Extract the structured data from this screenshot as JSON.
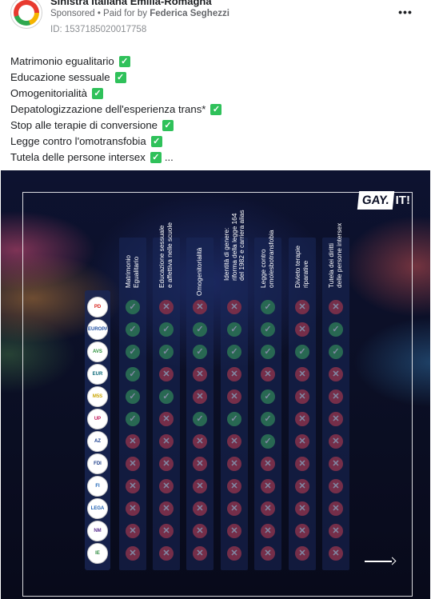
{
  "header": {
    "page_name": "Sinistra Italiana Emilia-Romagna",
    "sponsored_label": "Sponsored",
    "paid_for_prefix": " • Paid for by ",
    "payer": "Federica Seghezzi",
    "ad_id": "ID: 1537185020017758",
    "more_icon": "more-horizontal-icon"
  },
  "body_lines": [
    "Matrimonio egualitario",
    "Educazione sessuale",
    "Omogenitorialità",
    "Depatologizzazione dell'esperienza trans*",
    "Stop alle terapie di conversione",
    "Legge contro l'omotransfobia",
    "Tutela delle persone intersex"
  ],
  "check_icon": "white-check-mark-icon",
  "ellipsis": "...",
  "creative": {
    "logo_gay": "GAY.",
    "logo_it": "IT!",
    "columns": [
      "Matrimonio\nEgualitario",
      "Educazione sessuale\ne affettiva nelle scuole",
      "Omogenitorialità",
      "Identità di genere:\nriforma della legge 164\ndel 1982 e carriera alias",
      "Legge contro\nomolesbotransfobia",
      "Divieto terapie\nriparative",
      "Tutela dei diritti\ndelle persone intersex"
    ],
    "parties": [
      {
        "abbr": "PD",
        "color": "#d7261e"
      },
      {
        "abbr": "EUROPA",
        "color": "#1f4fa3"
      },
      {
        "abbr": "AVS",
        "color": "#2b8f3b"
      },
      {
        "abbr": "EUR",
        "color": "#0c6a7a"
      },
      {
        "abbr": "M5S",
        "color": "#c9a400"
      },
      {
        "abbr": "UP",
        "color": "#c2185b"
      },
      {
        "abbr": "AZ",
        "color": "#143a8c"
      },
      {
        "abbr": "FDI",
        "color": "#1e3f8a"
      },
      {
        "abbr": "FI",
        "color": "#1a62b5"
      },
      {
        "abbr": "LEGA",
        "color": "#1f5fb0"
      },
      {
        "abbr": "NM",
        "color": "#5a2f8f"
      },
      {
        "abbr": "IE",
        "color": "#2c8a3d"
      }
    ],
    "matrix": [
      [
        1,
        0,
        0,
        0,
        1,
        0,
        0
      ],
      [
        1,
        1,
        1,
        1,
        1,
        0,
        1
      ],
      [
        1,
        1,
        1,
        1,
        1,
        1,
        1
      ],
      [
        1,
        0,
        0,
        0,
        0,
        0,
        0
      ],
      [
        1,
        1,
        0,
        0,
        1,
        0,
        0
      ],
      [
        1,
        0,
        1,
        1,
        1,
        0,
        0
      ],
      [
        0,
        0,
        0,
        0,
        1,
        0,
        0
      ],
      [
        0,
        0,
        0,
        0,
        0,
        0,
        0
      ],
      [
        0,
        0,
        0,
        0,
        0,
        0,
        0
      ],
      [
        0,
        0,
        0,
        0,
        0,
        0,
        0
      ],
      [
        0,
        0,
        0,
        0,
        0,
        0,
        0
      ],
      [
        0,
        0,
        0,
        0,
        0,
        0,
        0
      ]
    ],
    "yes_icon": "check-circle-icon",
    "no_icon": "x-circle-icon",
    "arrow_icon": "arrow-right-icon"
  }
}
